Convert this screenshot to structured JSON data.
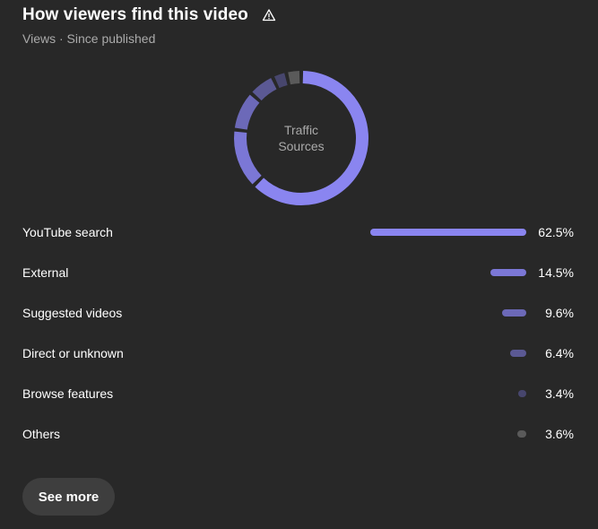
{
  "header": {
    "title": "How viewers find this video",
    "warning_icon": "warning-triangle-icon",
    "subtitle": "Views · Since published"
  },
  "donut": {
    "center_label_line1": "Traffic",
    "center_label_line2": "Sources"
  },
  "sources": [
    {
      "label": "YouTube search",
      "value": 62.5,
      "value_text": "62.5%",
      "color": "#8a85f0"
    },
    {
      "label": "External",
      "value": 14.5,
      "value_text": "14.5%",
      "color": "#7b77d6"
    },
    {
      "label": "Suggested videos",
      "value": 9.6,
      "value_text": "9.6%",
      "color": "#6c69b8"
    },
    {
      "label": "Direct or unknown",
      "value": 6.4,
      "value_text": "6.4%",
      "color": "#5b5994"
    },
    {
      "label": "Browse features",
      "value": 3.4,
      "value_text": "3.4%",
      "color": "#47466d"
    },
    {
      "label": "Others",
      "value": 3.6,
      "value_text": "3.6%",
      "color": "#5a5a5a"
    }
  ],
  "footer": {
    "see_more_label": "See more"
  }
}
